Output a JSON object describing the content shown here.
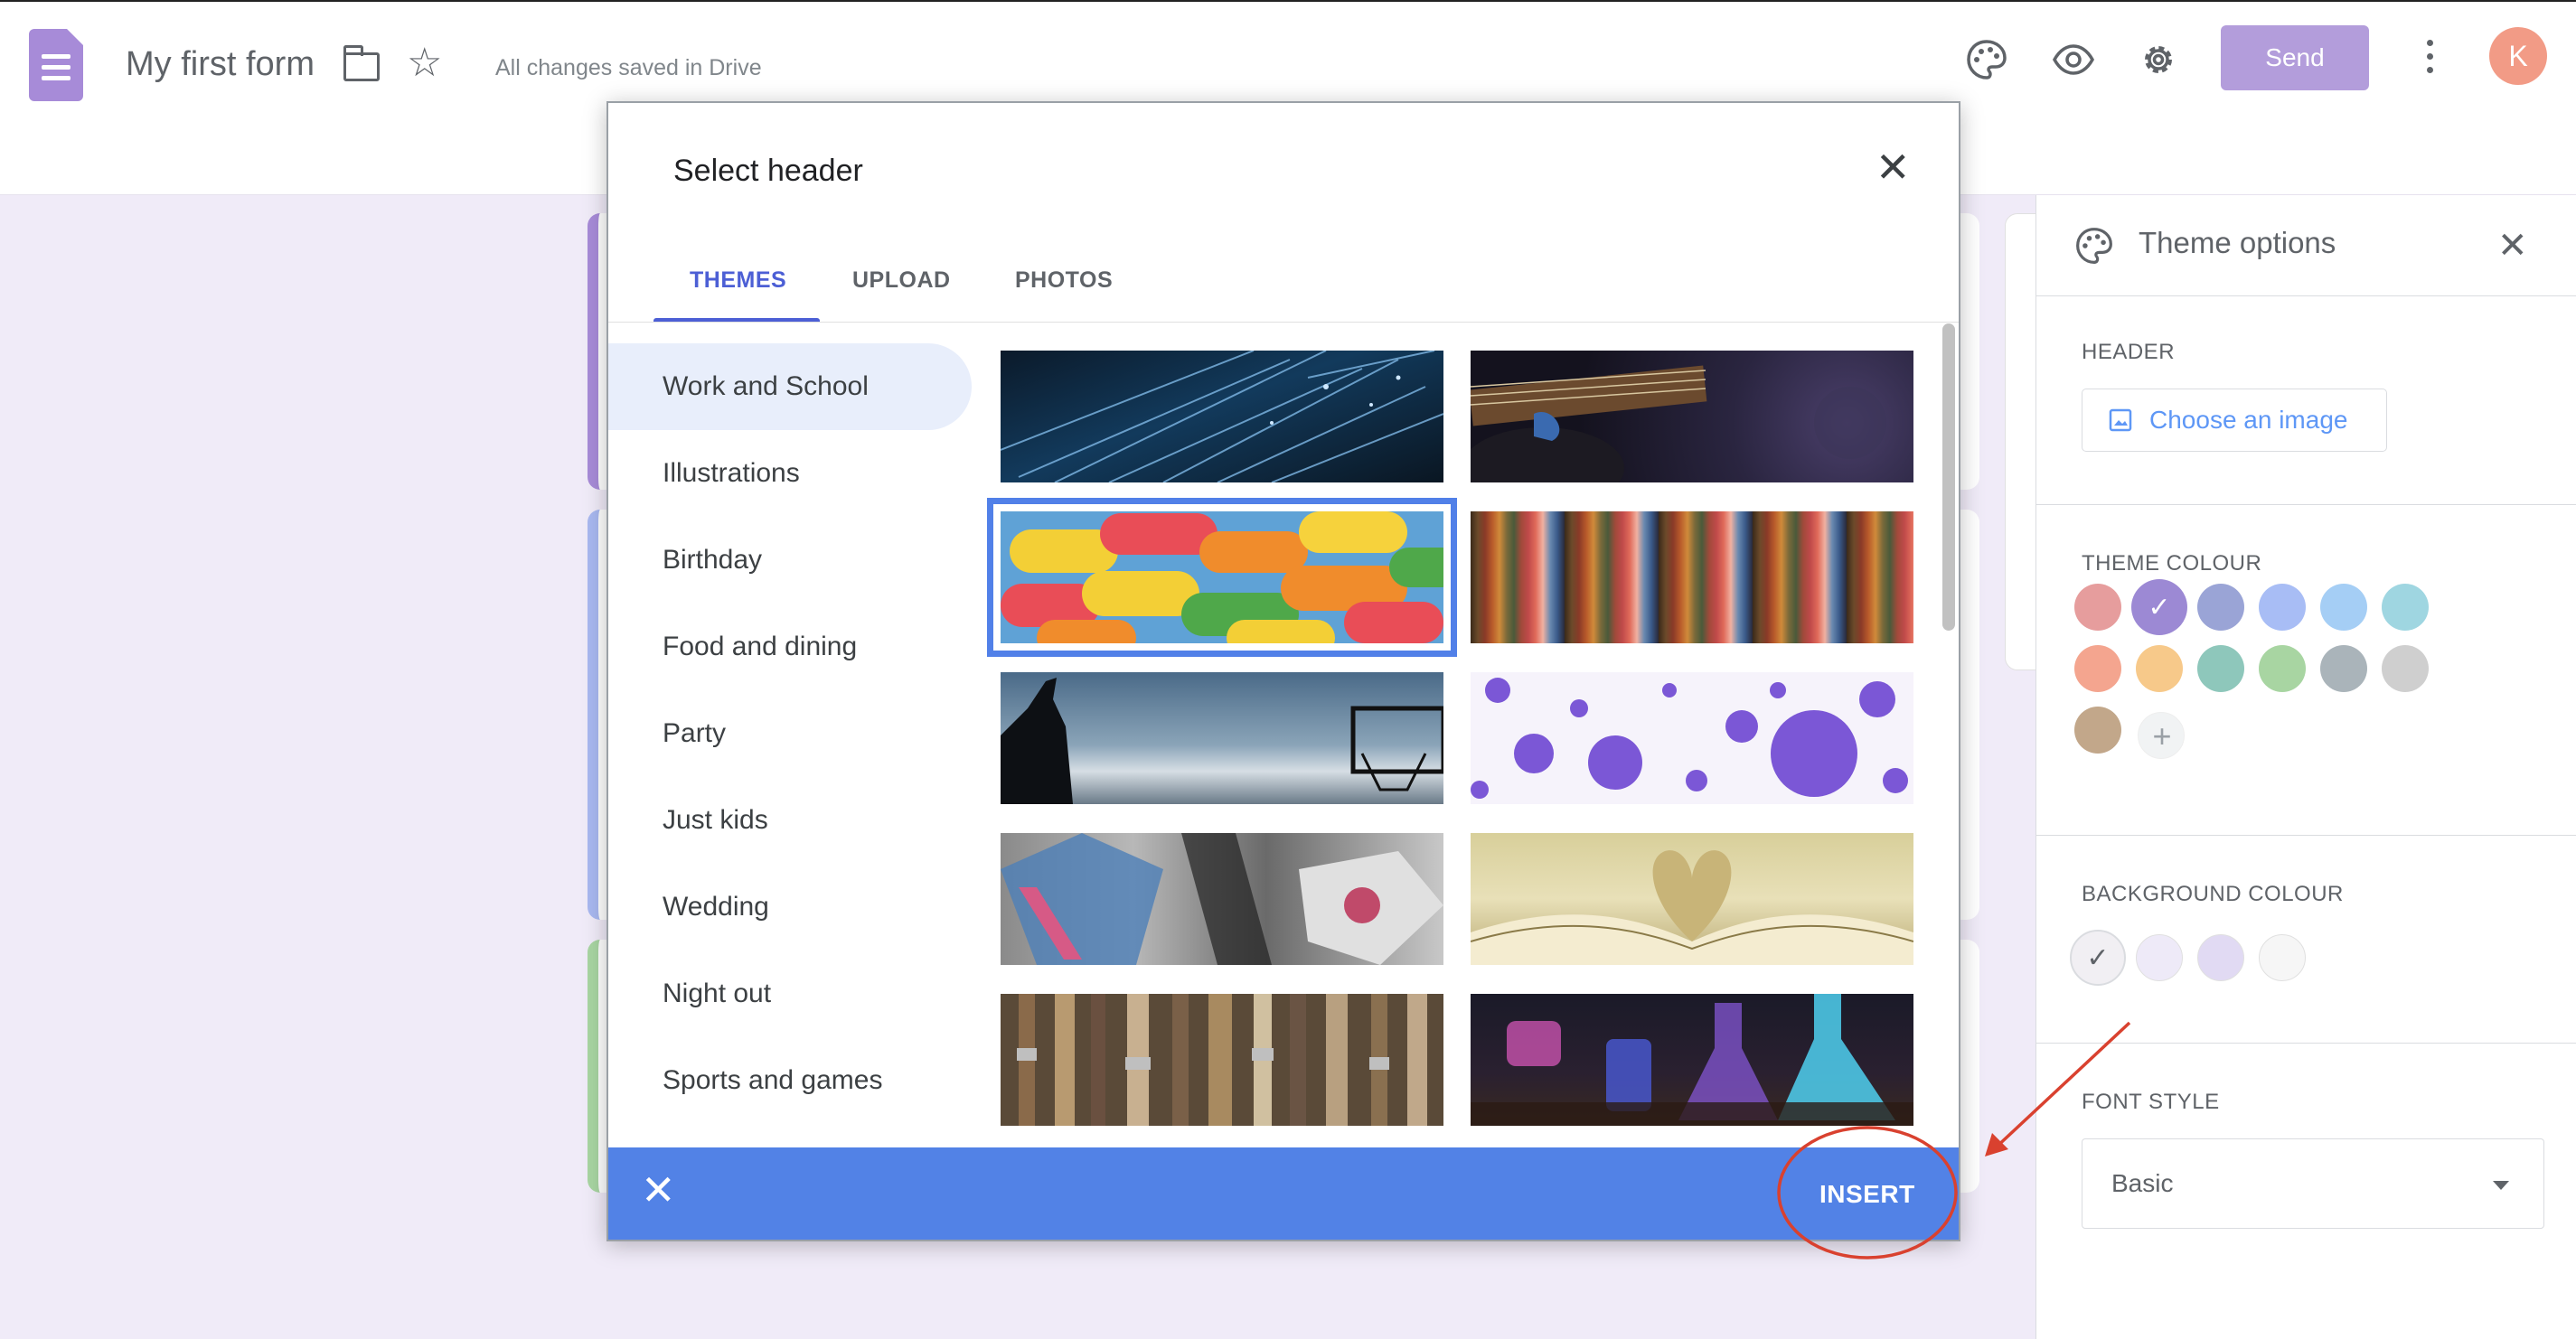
{
  "header": {
    "form_title": "My first form",
    "save_status": "All changes saved in Drive",
    "send_label": "Send",
    "avatar_initial": "K",
    "icons": [
      "form-doc-icon",
      "folder-icon",
      "star-icon",
      "palette-icon",
      "preview-eye-icon",
      "settings-gear-icon",
      "more-vert-icon"
    ]
  },
  "dialog": {
    "title": "Select header",
    "tabs": [
      "THEMES",
      "UPLOAD",
      "PHOTOS"
    ],
    "active_tab": "THEMES",
    "categories": [
      "Work and School",
      "Illustrations",
      "Birthday",
      "Food and dining",
      "Party",
      "Just kids",
      "Wedding",
      "Night out",
      "Sports and games"
    ],
    "active_category": "Work and School",
    "thumbnails": [
      "fiber-optic-lights",
      "guitar-player",
      "colorful-candy",
      "colored-threads",
      "basketball-hoop",
      "purple-spheres",
      "painted-hands",
      "open-book-heart",
      "paint-brushes",
      "chemistry-flasks"
    ],
    "selected_thumbnail": "colorful-candy",
    "insert_label": "INSERT"
  },
  "theme_panel": {
    "title": "Theme options",
    "header_label": "HEADER",
    "choose_image_label": "Choose an image",
    "theme_colour_label": "THEME COLOUR",
    "theme_colours": [
      "#e69d9d",
      "#9c89d4",
      "#9aa4d6",
      "#a8bdf5",
      "#a5cef5",
      "#9fd6e1",
      "#f4a58f",
      "#f7c98a",
      "#8ec7bb",
      "#a8d5a2",
      "#aab4ba",
      "#cfcfcf",
      "#c2a78a"
    ],
    "selected_theme_colour": "#9c89d4",
    "background_colour_label": "BACKGROUND COLOUR",
    "background_colours": [
      "#f1eff3",
      "#eeeaf8",
      "#e1daf3",
      "#f6f6f6"
    ],
    "selected_background_colour": "#f1eff3",
    "font_style_label": "FONT STYLE",
    "font_style_value": "Basic"
  }
}
